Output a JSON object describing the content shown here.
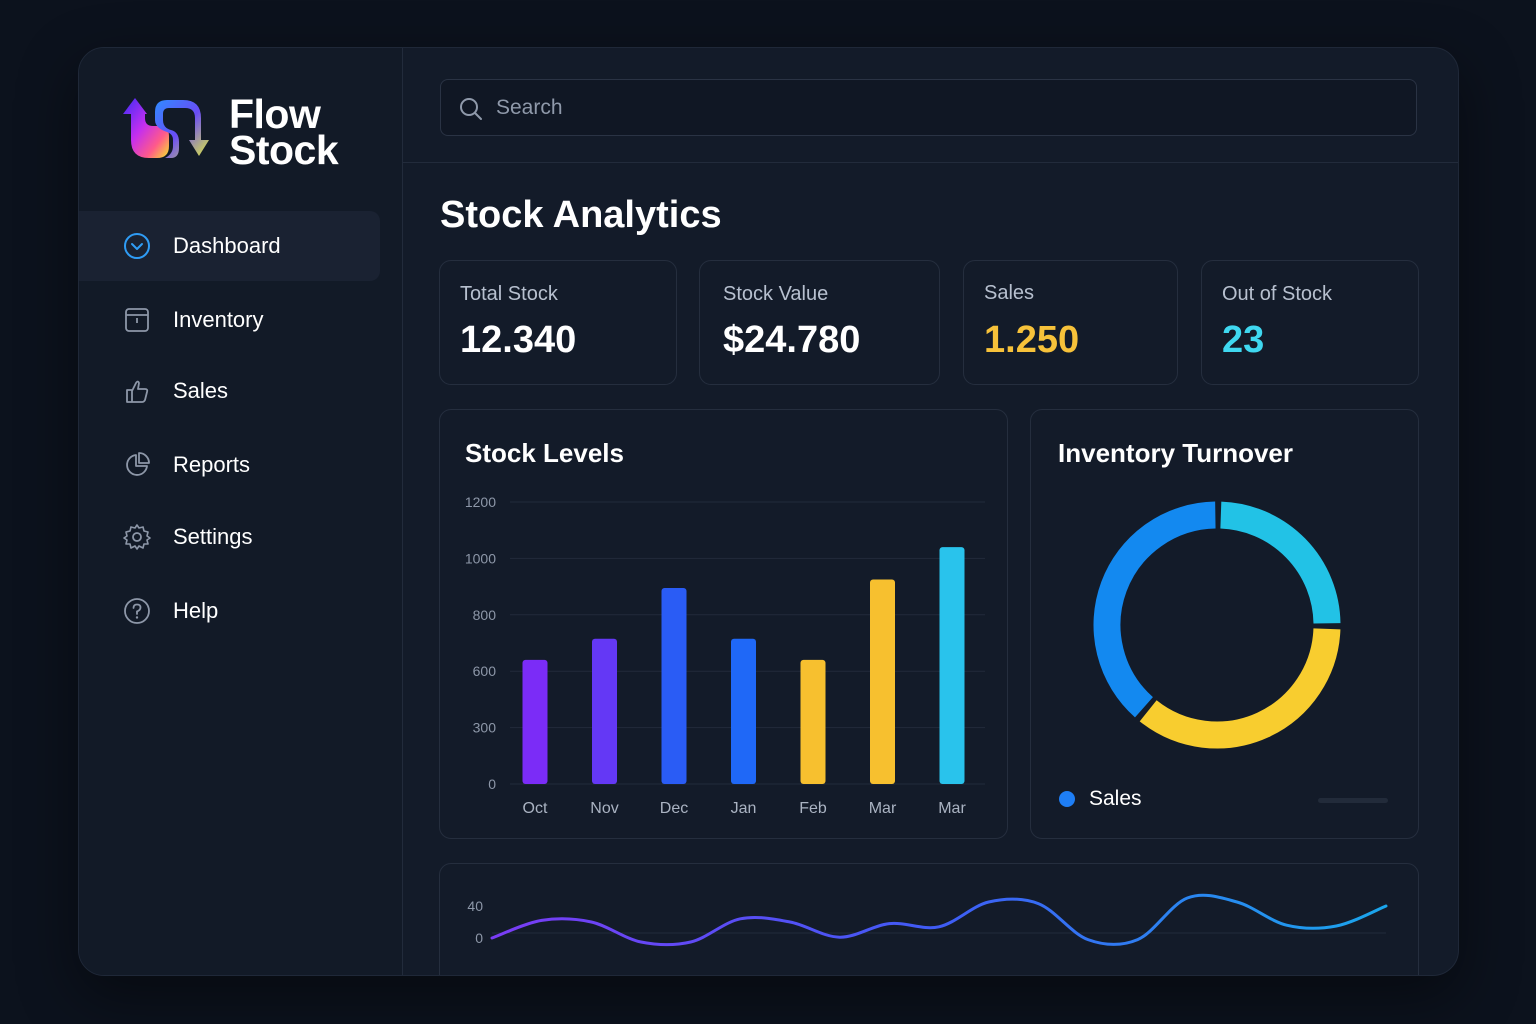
{
  "app": {
    "logo_line1": "Flow",
    "logo_line2": "Stock"
  },
  "sidebar": {
    "items": [
      {
        "label": "Dashboard",
        "icon": "chevron-circle-icon",
        "active": true
      },
      {
        "label": "Inventory",
        "icon": "box-icon",
        "active": false
      },
      {
        "label": "Sales",
        "icon": "hand-icon",
        "active": false
      },
      {
        "label": "Reports",
        "icon": "pie-icon",
        "active": false
      },
      {
        "label": "Settings",
        "icon": "gear-icon",
        "active": false
      },
      {
        "label": "Help",
        "icon": "help-icon",
        "active": false
      }
    ]
  },
  "search": {
    "placeholder": "Search"
  },
  "main": {
    "title": "Stock Analytics",
    "stats": [
      {
        "label": "Total Stock",
        "value": "12.340",
        "color": "#ffffff"
      },
      {
        "label": "Stock Value",
        "value": "$24.780",
        "color": "#ffffff"
      },
      {
        "label": "Sales",
        "value": "1.250",
        "color": "#f7c23a"
      },
      {
        "label": "Out of Stock",
        "value": "23",
        "color": "#3fd8f0"
      }
    ]
  },
  "colors": {
    "purple": "#7b2cf7",
    "violet": "#6438f5",
    "blue": "#2a5cf5",
    "blue2": "#1f68f7",
    "yellow": "#f7c02f",
    "cyan": "#29c3ec",
    "donut_blue": "#1389f0",
    "donut_cyan": "#22c2e6",
    "donut_yellow": "#f8cd2f"
  },
  "chart_data": [
    {
      "type": "bar",
      "title": "Stock Levels",
      "categories": [
        "Oct",
        "Nov",
        "Dec",
        "Jan",
        "Feb",
        "Mar",
        "Mar"
      ],
      "values": [
        640,
        715,
        895,
        715,
        640,
        925,
        1040
      ],
      "yticks": [
        "0",
        "300",
        "600",
        "800",
        "1000",
        "1200"
      ],
      "bar_colors": [
        "#7b2cf7",
        "#6438f5",
        "#2a5cf5",
        "#1f68f7",
        "#f7c02f",
        "#f7c02f",
        "#29c3ec"
      ],
      "grid": true
    },
    {
      "type": "pie",
      "title": "Inventory Turnover",
      "slices": [
        {
          "value": 25,
          "color": "#22c2e6"
        },
        {
          "value": 36,
          "color": "#f8cd2f"
        },
        {
          "value": 39,
          "color": "#1389f0"
        }
      ],
      "legend": [
        "Sales"
      ]
    },
    {
      "type": "line",
      "yticks": [
        "0",
        "40"
      ],
      "values": [
        0,
        22,
        20,
        -5,
        -5,
        24,
        20,
        1,
        18,
        14,
        45,
        43,
        -2,
        -2,
        50,
        45,
        16,
        15,
        40
      ],
      "grid": true
    }
  ]
}
